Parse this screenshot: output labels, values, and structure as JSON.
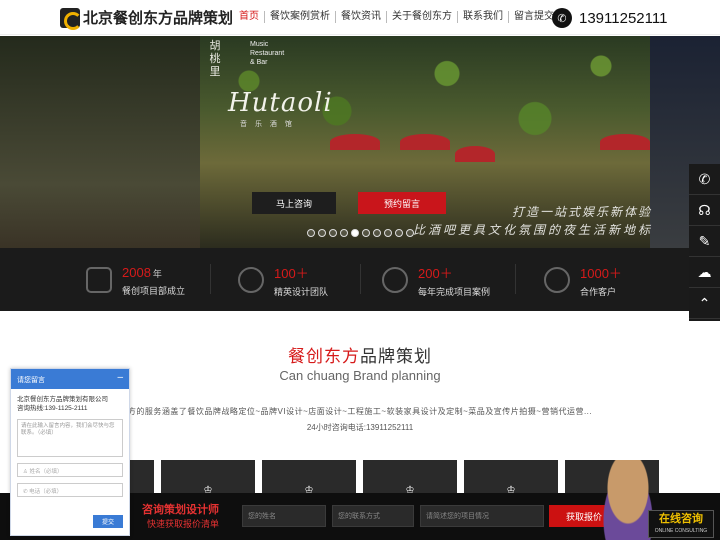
{
  "header": {
    "logo_text": "北京餐创东方品牌策划",
    "nav": [
      "首页",
      "餐饮案例赏析",
      "餐饮资讯",
      "关于餐创东方",
      "联系我们",
      "留言提交"
    ],
    "phone": "13911252111"
  },
  "hero": {
    "brand_cn": "胡桃里",
    "brand_music": "Music\nRestaurant\n& Bar",
    "brand_en": "Hutaoli",
    "brand_sub": "音 乐 酒 馆",
    "slogan1": "打造一站式娱乐新体验",
    "slogan2": "比酒吧更具文化氛围的夜生活新地标",
    "consult_btn": "马上咨询",
    "book_btn": "预约留言",
    "slide_count": 10,
    "active_slide": 5
  },
  "stats": [
    {
      "num": "2008",
      "unit": "年",
      "desc": "餐创项目部成立"
    },
    {
      "num": "100＋",
      "unit": "",
      "desc": "精英设计团队"
    },
    {
      "num": "200＋",
      "unit": "",
      "desc": "每年完成项目案例"
    },
    {
      "num": "1000＋",
      "unit": "",
      "desc": "合作客户"
    }
  ],
  "brand_section": {
    "title_red": "餐创东方",
    "title_rest": "品牌策划",
    "subtitle": "Can chuang Brand planning",
    "desc": "方的服务涵盖了餐饮品牌战略定位~品牌VI设计~店面设计~工程施工~软装家具设计及定制~菜品及宣传片拍摄~营销代运营...",
    "tel": "24小时咨询电话:13911252111"
  },
  "bottom_bar": {
    "title": "咨询策划设计师",
    "subtitle": "快速获取报价清单",
    "name_placeholder": "您的姓名",
    "contact_placeholder": "您的联系方式",
    "project_placeholder": "请简述您的项目情况",
    "quote_btn": "获取报价",
    "online_title": "在线咨询",
    "online_sub": "ONLINE CONSULTING"
  },
  "chat": {
    "header": "请您留言",
    "company": "北京餐创东方品牌策划有限公司",
    "hotline": "咨询热线:139-1125-2111",
    "msg_placeholder": "请在此输入留言内容，我们会尽快与您联系。（必填）",
    "name_placeholder": "姓名（必填）",
    "phone_placeholder": "电话（必填）",
    "submit": "提交"
  },
  "colors": {
    "accent": "#d61a1a",
    "chat_blue": "#3a7bd5",
    "dark": "#1b1b1b"
  }
}
